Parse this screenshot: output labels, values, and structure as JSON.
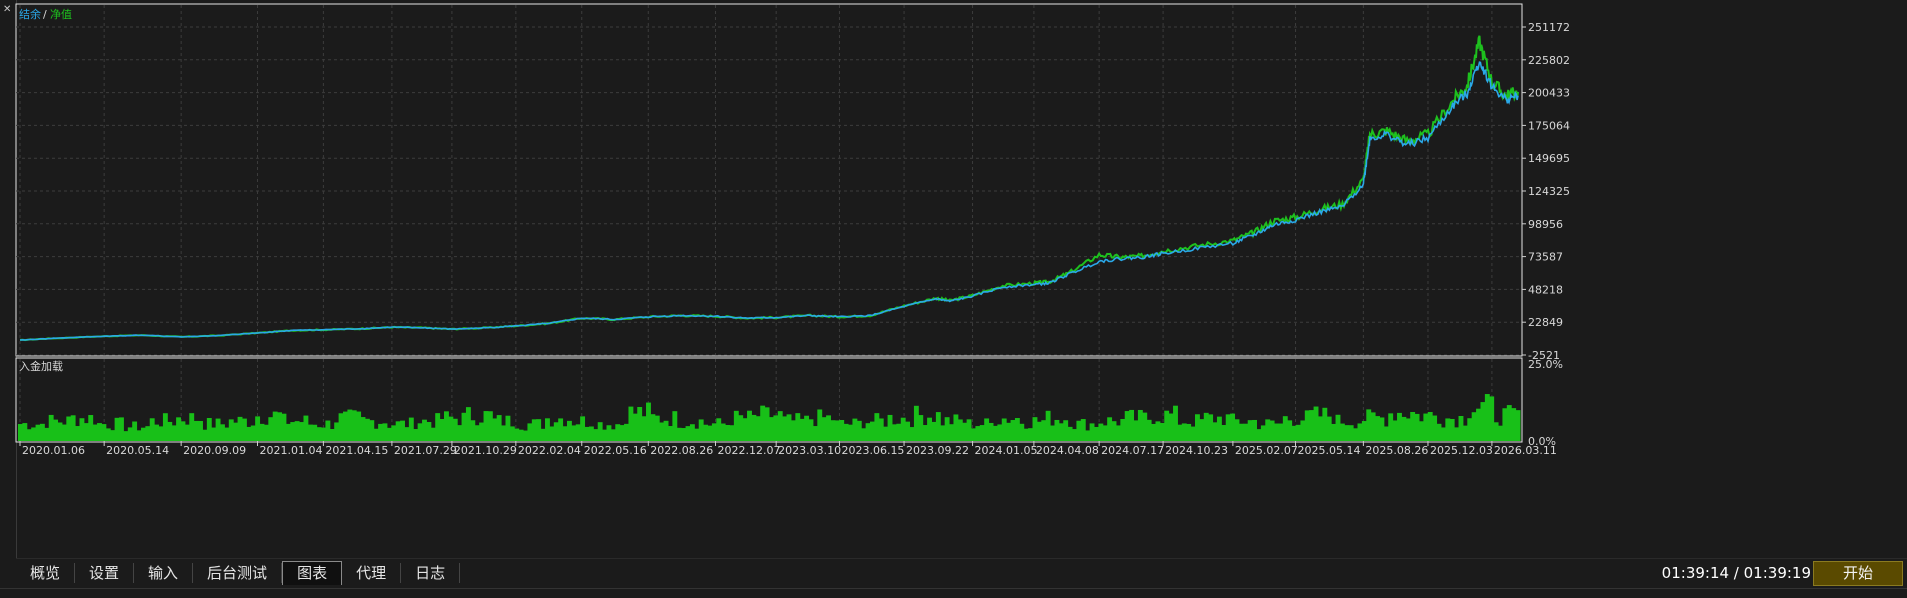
{
  "colors": {
    "background": "#1b1b1b",
    "balance": "#2aa8e8",
    "equity": "#1ec01e",
    "deposit_load": "#18c018",
    "grid": "#3c3c3c",
    "axis_text": "#d8d8d8",
    "start_button": "#5a4a00"
  },
  "chart_data": [
    {
      "type": "line",
      "legend": {
        "balance": "结余",
        "separator": "/",
        "equity": "净值",
        "placement": "top-left"
      },
      "y_ticks": [
        "251172",
        "225802",
        "200433",
        "175064",
        "149695",
        "124325",
        "98956",
        "73587",
        "48218",
        "22849",
        "-2521"
      ],
      "ylim": [
        -2521,
        251172
      ],
      "grid": true,
      "x_ticks": [
        "2020.01.06",
        "2020.05.14",
        "2020.09.09",
        "2021.01.04",
        "2021.04.15",
        "2021.07.29",
        "2021.10.29",
        "2022.02.04",
        "2022.05.16",
        "2022.08.26",
        "2022.12.07",
        "2023.03.10",
        "2023.06.15",
        "2023.09.22",
        "2024.01.05",
        "2024.04.08",
        "2024.07.17",
        "2024.10.23",
        "2025.02.07",
        "2025.05.14",
        "2025.08.26",
        "2025.12.03",
        "2026.03.11"
      ],
      "x": [
        "2020.01.06",
        "2020.03.01",
        "2020.05.14",
        "2020.07.10",
        "2020.09.09",
        "2020.11.05",
        "2021.01.04",
        "2021.02.25",
        "2021.04.15",
        "2021.06.10",
        "2021.07.29",
        "2021.09.15",
        "2021.10.29",
        "2021.12.20",
        "2022.02.04",
        "2022.03.28",
        "2022.05.16",
        "2022.07.05",
        "2022.08.26",
        "2022.10.15",
        "2022.12.07",
        "2023.01.25",
        "2023.03.10",
        "2023.05.01",
        "2023.06.15",
        "2023.08.01",
        "2023.09.22",
        "2023.11.10",
        "2023.12.01",
        "2024.01.05",
        "2024.02.20",
        "2024.04.08",
        "2024.05.01",
        "2024.06.01",
        "2024.07.17",
        "2024.08.20",
        "2024.09.20",
        "2024.10.23",
        "2024.12.15",
        "2025.02.07",
        "2025.03.10",
        "2025.04.10",
        "2025.05.14",
        "2025.06.20",
        "2025.07.25",
        "2025.08.26",
        "2025.09.05",
        "2025.10.01",
        "2025.11.01",
        "2025.12.03",
        "2026.01.10",
        "2026.02.01",
        "2026.02.20",
        "2026.03.11",
        "2026.04.01",
        "2026.04.20"
      ],
      "series": [
        {
          "name": "结余",
          "values": [
            9000,
            10500,
            12000,
            12800,
            11500,
            12500,
            14500,
            16500,
            17000,
            17800,
            19000,
            18500,
            17500,
            18500,
            20000,
            22000,
            26000,
            25000,
            27000,
            28000,
            27500,
            26000,
            26500,
            28000,
            27000,
            28000,
            35000,
            41000,
            39000,
            43000,
            50000,
            52000,
            53000,
            60000,
            70000,
            72000,
            73000,
            76000,
            80000,
            84000,
            90000,
            98000,
            102000,
            108000,
            112000,
            130000,
            165000,
            168000,
            160000,
            165000,
            190000,
            200000,
            225000,
            205000,
            195000,
            198000
          ]
        },
        {
          "name": "净值",
          "values": [
            9000,
            10500,
            12000,
            12800,
            11500,
            12500,
            14500,
            16500,
            17000,
            17800,
            19000,
            18500,
            17500,
            18500,
            20000,
            22000,
            26000,
            25000,
            27000,
            28000,
            27500,
            26000,
            26500,
            28000,
            27000,
            28000,
            35500,
            41500,
            39500,
            43500,
            51000,
            53000,
            54000,
            61000,
            75000,
            73000,
            74000,
            78000,
            82000,
            86000,
            92000,
            101000,
            104000,
            110000,
            114000,
            133000,
            168000,
            171000,
            163000,
            168000,
            194000,
            206000,
            240000,
            209000,
            198000,
            201000
          ]
        }
      ]
    },
    {
      "type": "bar",
      "title": "入金加载",
      "y_ticks": [
        "25.0%",
        "0.0%"
      ],
      "ylim": [
        0,
        25
      ],
      "values": [
        6,
        7,
        8,
        6,
        5,
        7,
        8,
        6,
        7,
        9,
        7,
        6,
        8,
        7,
        6,
        7,
        8,
        9,
        7,
        6,
        8,
        7,
        6,
        10,
        8,
        7,
        6,
        8,
        9,
        7,
        8,
        6,
        7,
        8,
        9,
        7,
        6,
        8,
        7,
        8,
        6,
        7,
        8,
        9,
        7,
        8,
        7,
        6,
        8,
        9,
        7,
        8,
        10,
        9,
        8,
        12,
        9
      ]
    }
  ],
  "tabs": [
    {
      "label": "概览",
      "active": false
    },
    {
      "label": "设置",
      "active": false
    },
    {
      "label": "输入",
      "active": false
    },
    {
      "label": "后台测试",
      "active": false
    },
    {
      "label": "图表",
      "active": true
    },
    {
      "label": "代理",
      "active": false
    },
    {
      "label": "日志",
      "active": false
    }
  ],
  "status": {
    "time": "01:39:14 / 01:39:19",
    "start_label": "开始"
  }
}
